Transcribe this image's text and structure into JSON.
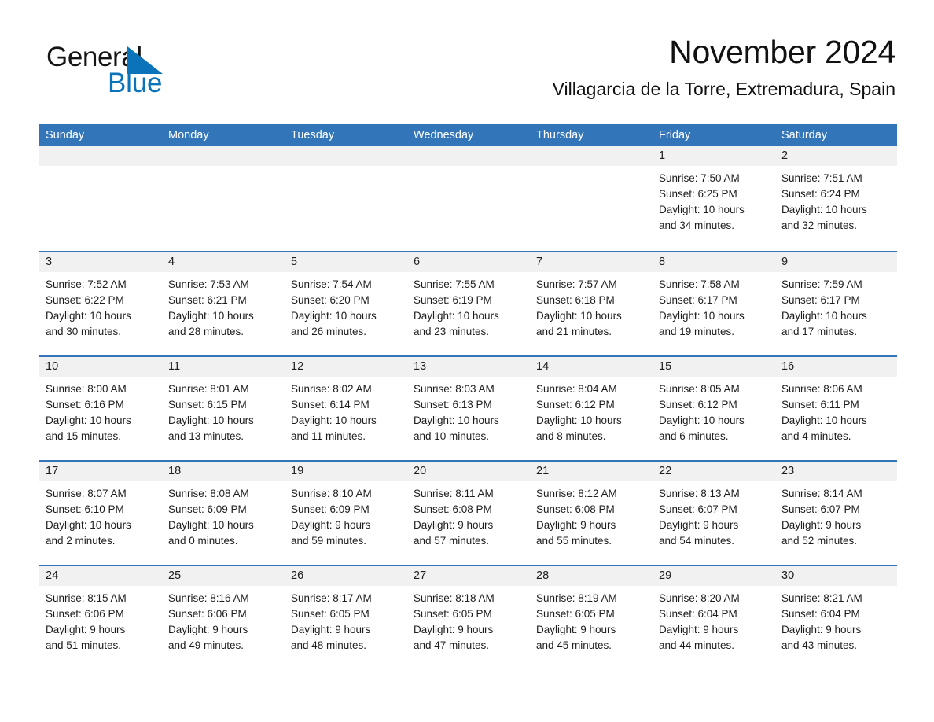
{
  "logo": {
    "word1": "General",
    "word2": "Blue",
    "triangle_icon": "triangle-icon",
    "colors": {
      "black": "#151515",
      "blue": "#0b73ba"
    }
  },
  "header": {
    "month_title": "November 2024",
    "location": "Villagarcia de la Torre, Extremadura, Spain"
  },
  "calendar": {
    "accent_color": "#3275b8",
    "day_band_color": "#f1f1f1",
    "weekdays": [
      "Sunday",
      "Monday",
      "Tuesday",
      "Wednesday",
      "Thursday",
      "Friday",
      "Saturday"
    ],
    "weeks": [
      [
        {
          "day": "",
          "empty": true
        },
        {
          "day": "",
          "empty": true
        },
        {
          "day": "",
          "empty": true
        },
        {
          "day": "",
          "empty": true
        },
        {
          "day": "",
          "empty": true
        },
        {
          "day": "1",
          "sunrise": "Sunrise: 7:50 AM",
          "sunset": "Sunset: 6:25 PM",
          "daylight_1": "Daylight: 10 hours",
          "daylight_2": "and 34 minutes."
        },
        {
          "day": "2",
          "sunrise": "Sunrise: 7:51 AM",
          "sunset": "Sunset: 6:24 PM",
          "daylight_1": "Daylight: 10 hours",
          "daylight_2": "and 32 minutes."
        }
      ],
      [
        {
          "day": "3",
          "sunrise": "Sunrise: 7:52 AM",
          "sunset": "Sunset: 6:22 PM",
          "daylight_1": "Daylight: 10 hours",
          "daylight_2": "and 30 minutes."
        },
        {
          "day": "4",
          "sunrise": "Sunrise: 7:53 AM",
          "sunset": "Sunset: 6:21 PM",
          "daylight_1": "Daylight: 10 hours",
          "daylight_2": "and 28 minutes."
        },
        {
          "day": "5",
          "sunrise": "Sunrise: 7:54 AM",
          "sunset": "Sunset: 6:20 PM",
          "daylight_1": "Daylight: 10 hours",
          "daylight_2": "and 26 minutes."
        },
        {
          "day": "6",
          "sunrise": "Sunrise: 7:55 AM",
          "sunset": "Sunset: 6:19 PM",
          "daylight_1": "Daylight: 10 hours",
          "daylight_2": "and 23 minutes."
        },
        {
          "day": "7",
          "sunrise": "Sunrise: 7:57 AM",
          "sunset": "Sunset: 6:18 PM",
          "daylight_1": "Daylight: 10 hours",
          "daylight_2": "and 21 minutes."
        },
        {
          "day": "8",
          "sunrise": "Sunrise: 7:58 AM",
          "sunset": "Sunset: 6:17 PM",
          "daylight_1": "Daylight: 10 hours",
          "daylight_2": "and 19 minutes."
        },
        {
          "day": "9",
          "sunrise": "Sunrise: 7:59 AM",
          "sunset": "Sunset: 6:17 PM",
          "daylight_1": "Daylight: 10 hours",
          "daylight_2": "and 17 minutes."
        }
      ],
      [
        {
          "day": "10",
          "sunrise": "Sunrise: 8:00 AM",
          "sunset": "Sunset: 6:16 PM",
          "daylight_1": "Daylight: 10 hours",
          "daylight_2": "and 15 minutes."
        },
        {
          "day": "11",
          "sunrise": "Sunrise: 8:01 AM",
          "sunset": "Sunset: 6:15 PM",
          "daylight_1": "Daylight: 10 hours",
          "daylight_2": "and 13 minutes."
        },
        {
          "day": "12",
          "sunrise": "Sunrise: 8:02 AM",
          "sunset": "Sunset: 6:14 PM",
          "daylight_1": "Daylight: 10 hours",
          "daylight_2": "and 11 minutes."
        },
        {
          "day": "13",
          "sunrise": "Sunrise: 8:03 AM",
          "sunset": "Sunset: 6:13 PM",
          "daylight_1": "Daylight: 10 hours",
          "daylight_2": "and 10 minutes."
        },
        {
          "day": "14",
          "sunrise": "Sunrise: 8:04 AM",
          "sunset": "Sunset: 6:12 PM",
          "daylight_1": "Daylight: 10 hours",
          "daylight_2": "and 8 minutes."
        },
        {
          "day": "15",
          "sunrise": "Sunrise: 8:05 AM",
          "sunset": "Sunset: 6:12 PM",
          "daylight_1": "Daylight: 10 hours",
          "daylight_2": "and 6 minutes."
        },
        {
          "day": "16",
          "sunrise": "Sunrise: 8:06 AM",
          "sunset": "Sunset: 6:11 PM",
          "daylight_1": "Daylight: 10 hours",
          "daylight_2": "and 4 minutes."
        }
      ],
      [
        {
          "day": "17",
          "sunrise": "Sunrise: 8:07 AM",
          "sunset": "Sunset: 6:10 PM",
          "daylight_1": "Daylight: 10 hours",
          "daylight_2": "and 2 minutes."
        },
        {
          "day": "18",
          "sunrise": "Sunrise: 8:08 AM",
          "sunset": "Sunset: 6:09 PM",
          "daylight_1": "Daylight: 10 hours",
          "daylight_2": "and 0 minutes."
        },
        {
          "day": "19",
          "sunrise": "Sunrise: 8:10 AM",
          "sunset": "Sunset: 6:09 PM",
          "daylight_1": "Daylight: 9 hours",
          "daylight_2": "and 59 minutes."
        },
        {
          "day": "20",
          "sunrise": "Sunrise: 8:11 AM",
          "sunset": "Sunset: 6:08 PM",
          "daylight_1": "Daylight: 9 hours",
          "daylight_2": "and 57 minutes."
        },
        {
          "day": "21",
          "sunrise": "Sunrise: 8:12 AM",
          "sunset": "Sunset: 6:08 PM",
          "daylight_1": "Daylight: 9 hours",
          "daylight_2": "and 55 minutes."
        },
        {
          "day": "22",
          "sunrise": "Sunrise: 8:13 AM",
          "sunset": "Sunset: 6:07 PM",
          "daylight_1": "Daylight: 9 hours",
          "daylight_2": "and 54 minutes."
        },
        {
          "day": "23",
          "sunrise": "Sunrise: 8:14 AM",
          "sunset": "Sunset: 6:07 PM",
          "daylight_1": "Daylight: 9 hours",
          "daylight_2": "and 52 minutes."
        }
      ],
      [
        {
          "day": "24",
          "sunrise": "Sunrise: 8:15 AM",
          "sunset": "Sunset: 6:06 PM",
          "daylight_1": "Daylight: 9 hours",
          "daylight_2": "and 51 minutes."
        },
        {
          "day": "25",
          "sunrise": "Sunrise: 8:16 AM",
          "sunset": "Sunset: 6:06 PM",
          "daylight_1": "Daylight: 9 hours",
          "daylight_2": "and 49 minutes."
        },
        {
          "day": "26",
          "sunrise": "Sunrise: 8:17 AM",
          "sunset": "Sunset: 6:05 PM",
          "daylight_1": "Daylight: 9 hours",
          "daylight_2": "and 48 minutes."
        },
        {
          "day": "27",
          "sunrise": "Sunrise: 8:18 AM",
          "sunset": "Sunset: 6:05 PM",
          "daylight_1": "Daylight: 9 hours",
          "daylight_2": "and 47 minutes."
        },
        {
          "day": "28",
          "sunrise": "Sunrise: 8:19 AM",
          "sunset": "Sunset: 6:05 PM",
          "daylight_1": "Daylight: 9 hours",
          "daylight_2": "and 45 minutes."
        },
        {
          "day": "29",
          "sunrise": "Sunrise: 8:20 AM",
          "sunset": "Sunset: 6:04 PM",
          "daylight_1": "Daylight: 9 hours",
          "daylight_2": "and 44 minutes."
        },
        {
          "day": "30",
          "sunrise": "Sunrise: 8:21 AM",
          "sunset": "Sunset: 6:04 PM",
          "daylight_1": "Daylight: 9 hours",
          "daylight_2": "and 43 minutes."
        }
      ]
    ]
  }
}
